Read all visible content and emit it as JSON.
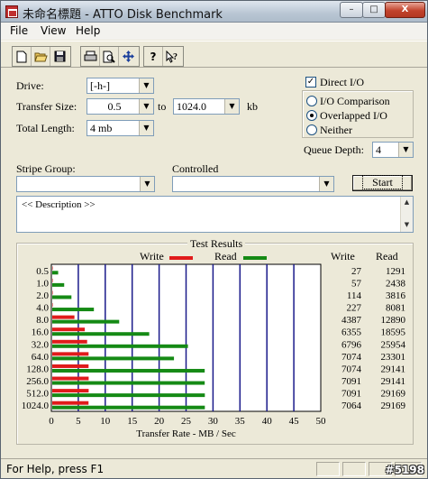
{
  "window": {
    "title": "未命名標題 - ATTO Disk Benchmark"
  },
  "titlebar_buttons": {
    "minimize": "–",
    "maximize": "□",
    "close": "X"
  },
  "menu": {
    "file": "File",
    "view": "View",
    "help": "Help"
  },
  "toolbar": {
    "icons": [
      "new-document-icon",
      "open-folder-icon",
      "save-disk-icon",
      "print-icon",
      "print-preview-icon",
      "move-cross-icon",
      "help-question-icon",
      "context-help-icon"
    ]
  },
  "form": {
    "drive_label": "Drive:",
    "drive_value": "[-h-]",
    "transfer_size_label": "Transfer Size:",
    "transfer_from": "0.5",
    "to_label": "to",
    "transfer_to": "1024.0",
    "kb_label": "kb",
    "total_length_label": "Total Length:",
    "total_length_value": "4 mb",
    "direct_io_label": "Direct I/O",
    "direct_io_checked": true,
    "io_comparison_label": "I/O Comparison",
    "overlapped_io_label": "Overlapped I/O",
    "neither_label": "Neither",
    "selected_io_mode": "Overlapped I/O",
    "queue_depth_label": "Queue Depth:",
    "queue_depth_value": "4",
    "stripe_group_label": "Stripe Group:",
    "stripe_group_value": "",
    "controlled_label": "Controlled",
    "controlled_value": "",
    "start_label": "Start",
    "description": "<< Description >>"
  },
  "results": {
    "title": "Test Results",
    "write_legend": "Write",
    "read_legend": "Read",
    "write_col": "Write",
    "read_col": "Read"
  },
  "chart_data": {
    "type": "bar",
    "orientation": "horizontal",
    "categories": [
      "0.5",
      "1.0",
      "2.0",
      "4.0",
      "8.0",
      "16.0",
      "32.0",
      "64.0",
      "128.0",
      "256.0",
      "512.0",
      "1024.0"
    ],
    "series": [
      {
        "name": "Write",
        "color": "#e01b1b",
        "values": [
          27,
          57,
          114,
          227,
          4387,
          6355,
          6796,
          7074,
          7074,
          7091,
          7091,
          7064
        ]
      },
      {
        "name": "Read",
        "color": "#158a15",
        "values": [
          1291,
          2438,
          3816,
          8081,
          12890,
          18595,
          25954,
          23301,
          29141,
          29141,
          29169,
          29169
        ]
      }
    ],
    "xlabel": "Transfer Rate - MB / Sec",
    "xlim": [
      0,
      50
    ],
    "xticks": [
      "0",
      "5",
      "10",
      "15",
      "20",
      "25",
      "30",
      "35",
      "40",
      "45",
      "50"
    ],
    "grid": true,
    "legend": "top"
  },
  "status": {
    "text": "For Help, press F1"
  },
  "watermark": "#5198"
}
